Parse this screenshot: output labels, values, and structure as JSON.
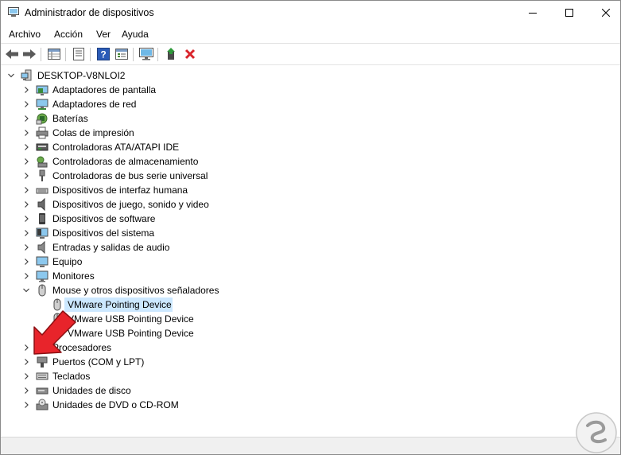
{
  "window": {
    "title": "Administrador de dispositivos"
  },
  "menu": {
    "items": [
      {
        "label": "Archivo"
      },
      {
        "label": "Acción"
      },
      {
        "label": "Ver"
      },
      {
        "label": "Ayuda"
      }
    ]
  },
  "toolbar": {
    "buttons": [
      "back-icon",
      "forward-icon",
      "properties-grid-icon",
      "device-properties-icon",
      "help-icon",
      "view-icon",
      "monitor-scan-icon",
      "update-driver-icon",
      "uninstall-icon"
    ],
    "uninstall_color": "#d9242b"
  },
  "tree": {
    "root": "DESKTOP-V8NLOI2",
    "categories": [
      {
        "label": "Adaptadores de pantalla",
        "icon": "display-adapter-icon",
        "expanded": false
      },
      {
        "label": "Adaptadores de red",
        "icon": "network-adapter-icon",
        "expanded": false
      },
      {
        "label": "Baterías",
        "icon": "battery-icon",
        "expanded": false
      },
      {
        "label": "Colas de impresión",
        "icon": "printer-icon",
        "expanded": false
      },
      {
        "label": "Controladoras ATA/ATAPI IDE",
        "icon": "ide-controller-icon",
        "expanded": false
      },
      {
        "label": "Controladoras de almacenamiento",
        "icon": "storage-controller-icon",
        "expanded": false
      },
      {
        "label": "Controladoras de bus serie universal",
        "icon": "usb-icon",
        "expanded": false
      },
      {
        "label": "Dispositivos de interfaz humana",
        "icon": "hid-icon",
        "expanded": false
      },
      {
        "label": "Dispositivos de juego, sonido y video",
        "icon": "speaker-icon",
        "expanded": false
      },
      {
        "label": "Dispositivos de software",
        "icon": "software-device-icon",
        "expanded": false
      },
      {
        "label": "Dispositivos del sistema",
        "icon": "system-device-icon",
        "expanded": false
      },
      {
        "label": "Entradas y salidas de audio",
        "icon": "audio-io-icon",
        "expanded": false
      },
      {
        "label": "Equipo",
        "icon": "computer-icon",
        "expanded": false
      },
      {
        "label": "Monitores",
        "icon": "monitor-icon",
        "expanded": false
      },
      {
        "label": "Mouse y otros dispositivos señaladores",
        "icon": "mouse-icon",
        "expanded": true,
        "children": [
          {
            "label": "VMware Pointing Device",
            "selected": true
          },
          {
            "label": "VMware USB Pointing Device",
            "selected": false
          },
          {
            "label": "VMware USB Pointing Device",
            "selected": false
          }
        ]
      },
      {
        "label": "Procesadores",
        "icon": "processor-icon",
        "expanded": false
      },
      {
        "label": "Puertos (COM y LPT)",
        "icon": "port-icon",
        "expanded": false
      },
      {
        "label": "Teclados",
        "icon": "keyboard-icon",
        "expanded": false
      },
      {
        "label": "Unidades de disco",
        "icon": "disk-drive-icon",
        "expanded": false
      },
      {
        "label": "Unidades de DVD o CD-ROM",
        "icon": "dvd-icon",
        "expanded": false
      }
    ]
  },
  "colors": {
    "selection": "#cce8ff",
    "arrow": "#e8242b",
    "arrow_outline": "#8b0f12"
  }
}
